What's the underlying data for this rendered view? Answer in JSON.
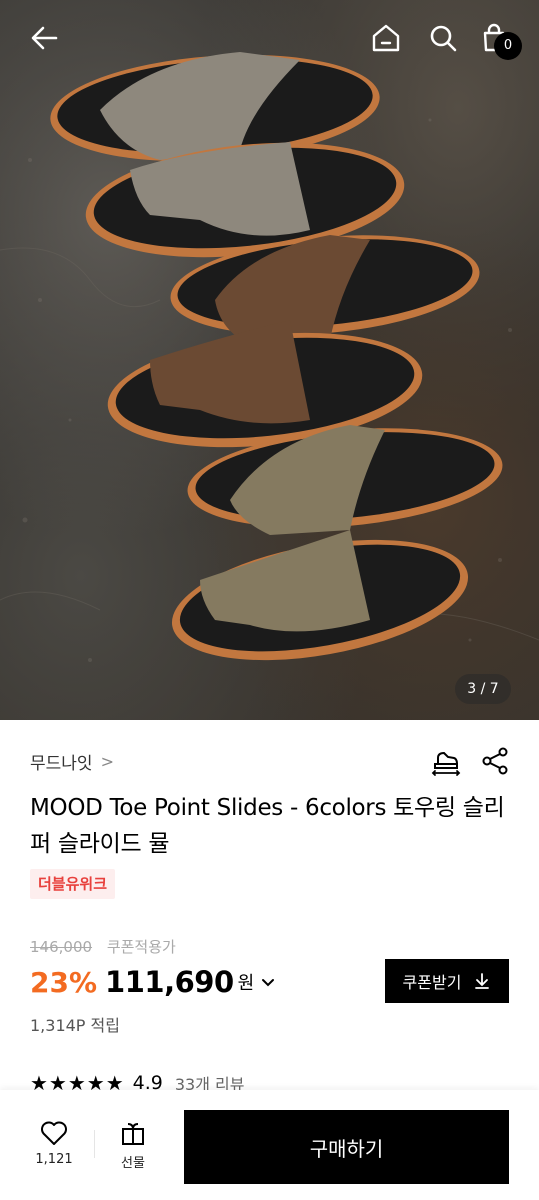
{
  "header": {
    "back_icon": "arrow-left-icon",
    "home_icon": "home-icon",
    "search_icon": "search-icon",
    "cart_icon": "shopping-bag-icon",
    "cart_count": "0"
  },
  "gallery": {
    "page_indicator": "3 / 7",
    "current_index": 3,
    "total": 7
  },
  "product": {
    "brand": "무드나잇",
    "brand_chevron": ">",
    "title": "MOOD Toe Point Slides - 6colors 토우링 슬리퍼 슬라이드 뮬",
    "tag": "더블유위크",
    "original_price": "146,000",
    "coupon_note": "쿠폰적용가",
    "discount": "23%",
    "price": "111,690",
    "currency": "원",
    "coupon_button": "쿠폰받기",
    "points": "1,314P 적립",
    "rating_stars": "★★★★★",
    "rating": "4.9",
    "reviews": "33개 리뷰"
  },
  "bottom_bar": {
    "like_count": "1,121",
    "gift_label": "선물",
    "buy_label": "구매하기"
  },
  "colors": {
    "accent_discount": "#f36b21",
    "tag_text": "#e8413d",
    "tag_bg": "#fdeeee",
    "button_bg": "#000000"
  }
}
